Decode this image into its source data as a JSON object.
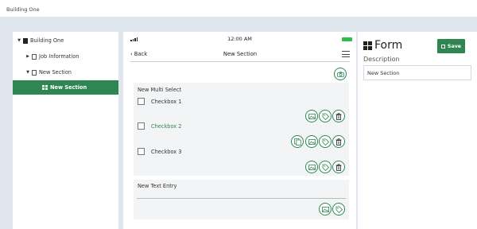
{
  "app": {
    "title": "Building One"
  },
  "tree": {
    "items": [
      {
        "label": "Building One",
        "expanded": true
      },
      {
        "label": "Job Information",
        "expanded": false
      },
      {
        "label": "New Section",
        "expanded": true
      },
      {
        "label": "New Section",
        "selected": true
      }
    ]
  },
  "phone": {
    "time": "12:00 AM",
    "back_label": "Back",
    "title": "New Section"
  },
  "multi_select": {
    "title": "New Multi Select",
    "checkboxes": [
      {
        "label": "Checkbox 1",
        "checked": false,
        "highlight": false
      },
      {
        "label": "Checkbox 2",
        "checked": false,
        "highlight": true
      },
      {
        "label": "Checkbox 3",
        "checked": false,
        "highlight": false
      }
    ]
  },
  "text_entry": {
    "title": "New Text Entry",
    "value": ""
  },
  "form": {
    "title": "Form",
    "save_label": "Save",
    "description_label": "Description",
    "description_value": "New Section"
  },
  "colors": {
    "accent": "#2f8653",
    "battery": "#2ebd4a",
    "background": "#dfe6ee"
  },
  "icons": [
    "camera-icon",
    "image-icon",
    "tag-icon",
    "trash-icon",
    "copy-icon",
    "save-icon",
    "hamburger-menu-icon",
    "chevron-left-icon"
  ]
}
